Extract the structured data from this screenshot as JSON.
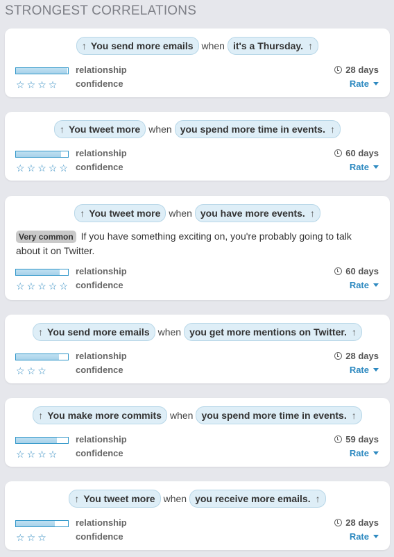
{
  "heading": "STRONGEST CORRELATIONS",
  "labels": {
    "relationship": "relationship",
    "confidence": "confidence",
    "rate": "Rate"
  },
  "icons": {
    "arrow": "up-arrow-icon",
    "clock": "clock-icon",
    "star": "star-outline-icon",
    "caret": "caret-down-icon"
  },
  "colors": {
    "accent": "#2d89c0",
    "pill_bg": "#deeef7",
    "page_bg": "#e6e7ec"
  },
  "cards": [
    {
      "left": "You send more emails",
      "when": "when",
      "right": "it's a Thursday.",
      "stars": [
        "☆",
        "☆",
        "☆",
        "☆"
      ],
      "strength": 0.99,
      "days": "28 days"
    },
    {
      "left": "You tweet more",
      "when": "when",
      "right": "you spend more time in events.",
      "stars": [
        "☆",
        "☆",
        "☆",
        "☆",
        "☆"
      ],
      "strength": 0.86,
      "days": "60 days"
    },
    {
      "left": "You tweet more",
      "when": "when",
      "right": "you have more events.",
      "badge": "Very common",
      "description": "If you have something exciting on, you're probably going to talk about it on Twitter.",
      "stars": [
        "☆",
        "☆",
        "☆",
        "☆",
        "☆"
      ],
      "strength": 0.84,
      "days": "60 days"
    },
    {
      "left": "You send more emails",
      "when": "when",
      "right": "you get more mentions on Twitter.",
      "stars": [
        "☆",
        "☆",
        "☆"
      ],
      "strength": 0.82,
      "days": "28 days"
    },
    {
      "left": "You make more commits",
      "when": "when",
      "right": "you spend more time in events.",
      "stars": [
        "☆",
        "☆",
        "☆",
        "☆"
      ],
      "strength": 0.78,
      "days": "59 days"
    },
    {
      "left": "You tweet more",
      "when": "when",
      "right": "you receive more emails.",
      "stars": [
        "☆",
        "☆",
        "☆"
      ],
      "strength": 0.74,
      "days": "28 days"
    }
  ]
}
